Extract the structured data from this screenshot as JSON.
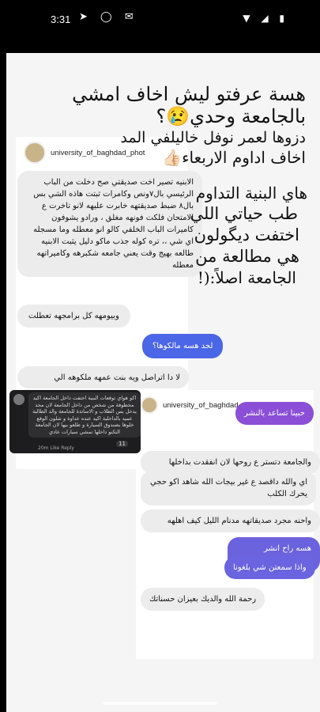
{
  "status_bar": {
    "time": "3:31"
  },
  "overlay": {
    "line1": "هسة عرفتو ليش اخاف امشي",
    "line2": "بالجامعة وحدي😢؟",
    "line3": "دزوها لعمر نوفل خاليلفي المد",
    "line4": "اخاف اداوم الاربعاء👍🏻",
    "side1": "هاي البنية التداوم",
    "side2": "طب حياتي اللي",
    "side3": "اختفت ديگولون",
    "side4": "هي مطالعة من",
    "side5": "الجامعة اصلاً:(!"
  },
  "top_card": {
    "username": "university_of_baghdad_phot",
    "messages": [
      "الابنيه تصير اخت صديقتي صح دخلت من الباب الرئيسي  بال٧ونص وكامرات ثبتت هاذه الشي  بس بال٨ ضبط صديقتهه خابرت عليهه لانو  تاخرت ع الامتحان فلكت فونهه مغلق ، ورادو يشوفون كاميرات الباب الخلفي كالو انو معطله وما مسجله اي شي ،، تره كوله جذب ماكو دليل يثبت الابنيه طالعه بهيج وقت يعني جامعه شكبرهه وكاميراتهه معطله",
      "وبيومهه كل برامجهه تعطلت",
      "لحد هسه مالكوها؟",
      "لا دا اتراصل  ويه بنت عمهه ملكوهه  الي"
    ]
  },
  "fb_comment": {
    "text": "اكو هواي توقعات البنية اختفت داخل الجامعة اكيد مخطوفة من شخص من داخل الجامعة لان محد يدخل بس الطلاب و الاساتذة للجامعة والد الطالبة عميد بالداخلية اكيد عنده عداوة و شلون الوقع خلوها بصندوق السيارة و طلعو بيها لان الجامعة التكنو داخلها تمشي سيارات عادي",
    "time": "20m",
    "like": "Like",
    "reply": "Reply",
    "reactions": "11"
  },
  "bottom_card": {
    "username": "university_of_baghdad_photos",
    "messages": [
      "حبينا تساعد بالنشر",
      "والجامعة دتستر ع روحها لان انفقدت بداخلها",
      "اي والله داقصد ع غير بيجات الله شاهد اكو حجي يحرك الكلب",
      "واحنه مجرد صديقاتهه مدنام الليل كيف اهلهه",
      "هسه راح انشر واقهمهم",
      "واذا سمعتن شي بلغونا",
      "رحمة الله والديك بعيزان حسناتك"
    ]
  }
}
